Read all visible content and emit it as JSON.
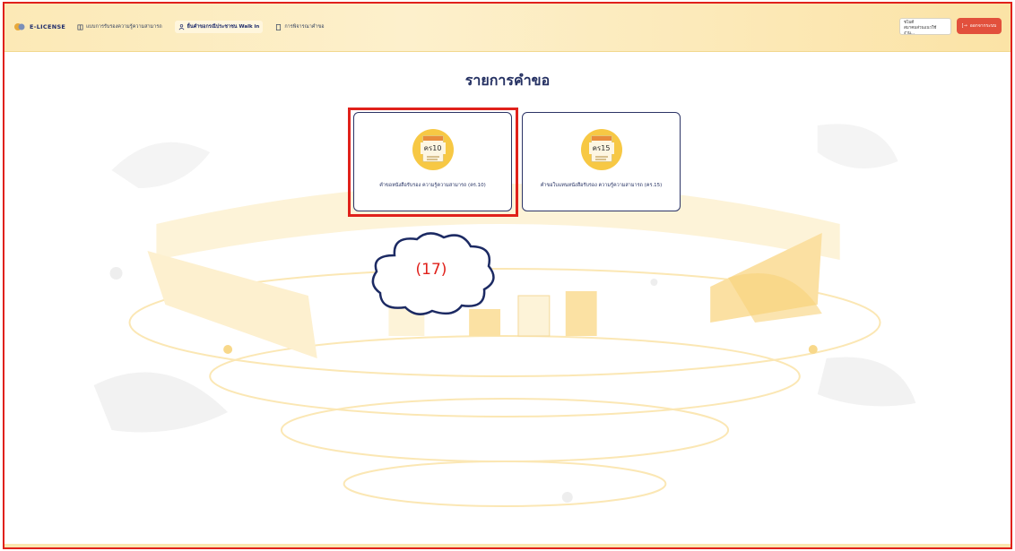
{
  "header": {
    "brand": "E-LICENSE",
    "nav": [
      {
        "label": "แบบการรับรองความรู้ความสามารถ",
        "active": false,
        "icon": "book-icon"
      },
      {
        "label": "ยื่นคำขอกรณีประชาชน Walk in",
        "active": true,
        "icon": "user-walk-icon"
      },
      {
        "label": "การพิจารณาคำขอ",
        "active": false,
        "icon": "document-icon"
      }
    ],
    "user": {
      "name": "ชไมดี",
      "role": "สมาคมส่วนแนวใช้งาน..."
    },
    "logout_label": "ออกจากระบบ"
  },
  "main": {
    "title": "รายการคำขอ",
    "cards": [
      {
        "code": "คร10",
        "label": "คำขอหนังสือรับรอง ความรู้ความสามารถ (คร.10)"
      },
      {
        "code": "คร15",
        "label": "คำขอใบแทนหนังสือรับรอง ความรู้ความสามารถ (คร.15)"
      }
    ]
  },
  "annotation": {
    "label": "(17)"
  },
  "colors": {
    "accent": "#e0211b",
    "navy": "#243062",
    "gold": "#f7c844"
  }
}
